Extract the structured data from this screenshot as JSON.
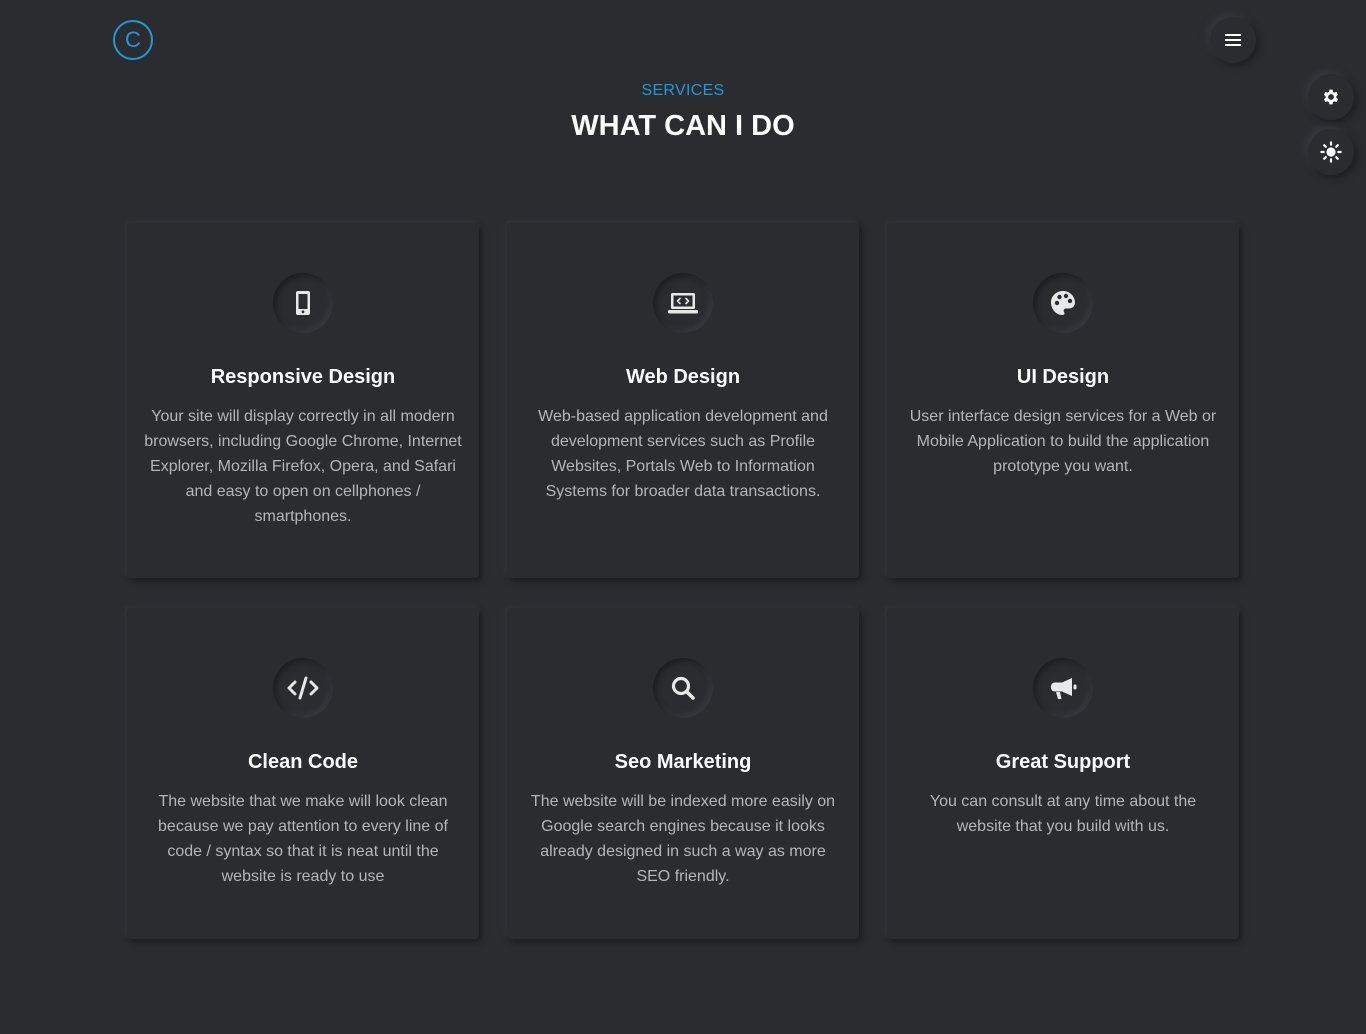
{
  "header": {
    "logo_letter": "C",
    "menu_icon": "hamburger-icon"
  },
  "side_controls": {
    "settings_icon": "gear-icon",
    "theme_icon": "sun-icon"
  },
  "section": {
    "label": "SERVICES",
    "title": "WHAT CAN I DO"
  },
  "colors": {
    "background": "#2b2c30",
    "accent": "#1e9bd7",
    "text": "#b6b6b8",
    "heading": "#ffffff"
  },
  "services": [
    {
      "icon": "mobile-phone-icon",
      "title": "Responsive Design",
      "text": "Your site will display correctly in all modern browsers, including Google Chrome, Internet Explorer, Mozilla Firefox, Opera, and Safari and easy to open on cellphones / smartphones."
    },
    {
      "icon": "laptop-code-icon",
      "title": "Web Design",
      "text": "Web-based application development and development services such as Profile Websites, Portals Web to Information Systems for broader data transactions."
    },
    {
      "icon": "palette-icon",
      "title": "UI Design",
      "text": "User interface design services for a Web or Mobile Application to build the application prototype you want."
    },
    {
      "icon": "code-icon",
      "title": "Clean Code",
      "text": "The website that we make will look clean because we pay attention to every line of code / syntax so that it is neat until the website is ready to use"
    },
    {
      "icon": "search-icon",
      "title": "Seo Marketing",
      "text": "The website will be indexed more easily on Google search engines because it looks already designed in such a way as more SEO friendly."
    },
    {
      "icon": "megaphone-icon",
      "title": "Great Support",
      "text": "You can consult at any time about the website that you build with us."
    }
  ]
}
